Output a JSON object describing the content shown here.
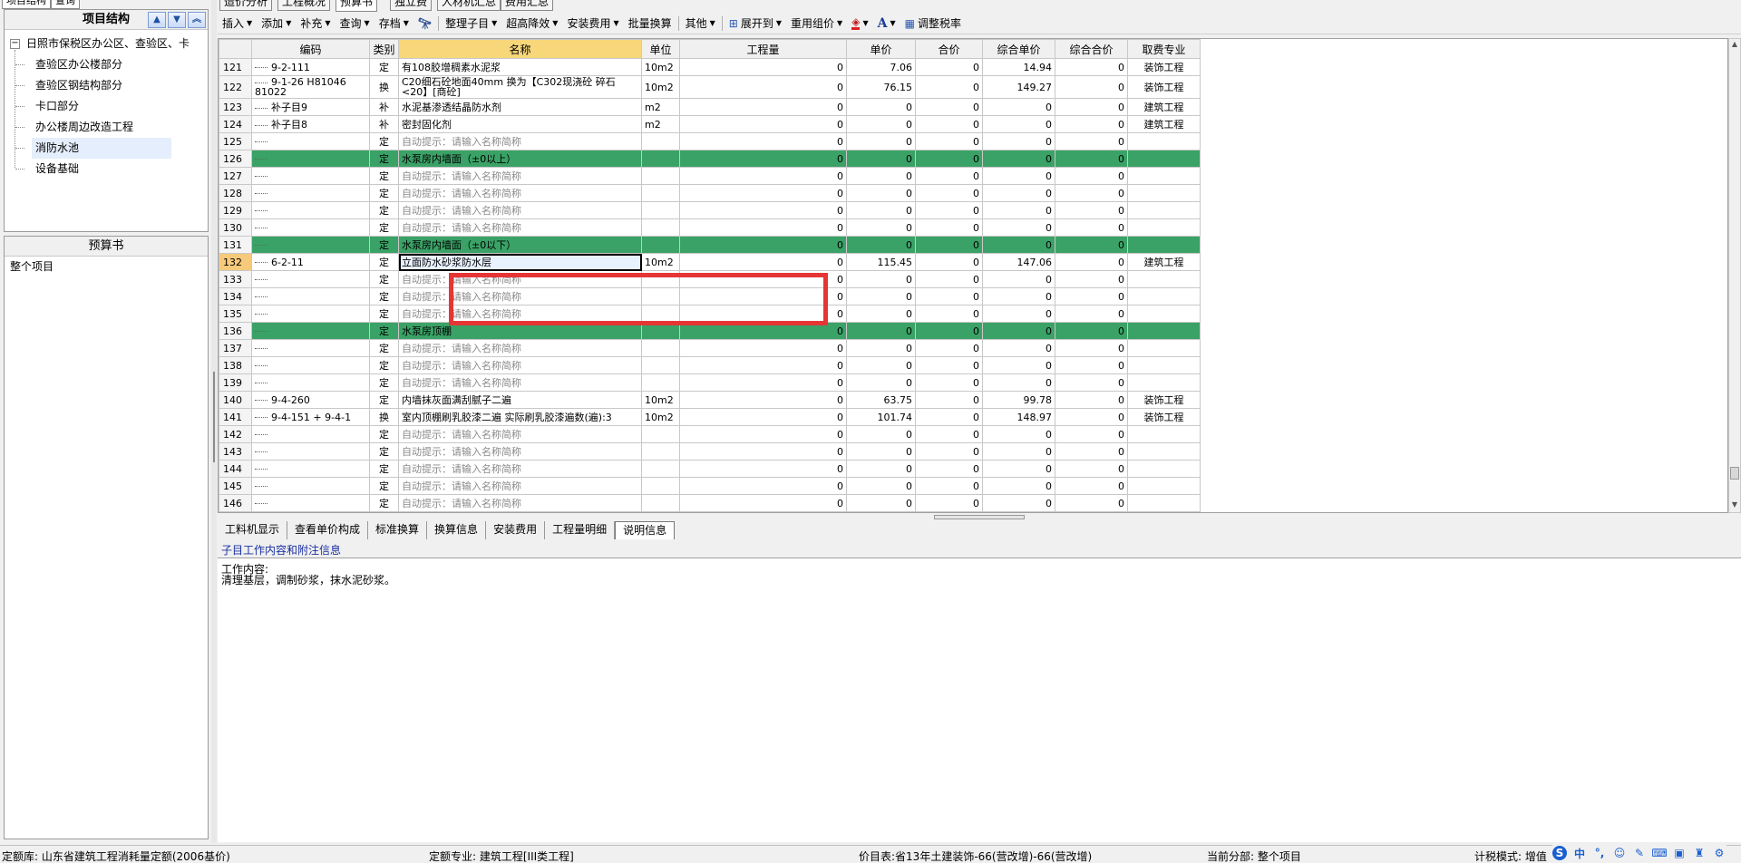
{
  "left_tabs": [
    "项目结构",
    "查询"
  ],
  "project_panel": {
    "title": "项目结构",
    "root": "日照市保税区办公区、查验区、卡",
    "items": [
      "查验区办公楼部分",
      "查验区钢结构部分",
      "卡口部分",
      "办公楼周边改造工程",
      "消防水池",
      "设备基础"
    ],
    "selected_index": 4
  },
  "budget_panel": {
    "title": "预算书",
    "items": [
      "整个项目"
    ]
  },
  "main_tabs": [
    "造价分析",
    "工程概况",
    "预算书",
    "独立费",
    "人材机汇总",
    "费用汇总"
  ],
  "active_main_tab": 2,
  "toolbar": [
    "插入",
    "添加",
    "补充",
    "查询",
    "存档",
    "",
    "整理子目",
    "超高降效",
    "安装费用",
    "批量换算",
    "其他",
    "展开到",
    "重用组价",
    "",
    "A",
    "调整税率"
  ],
  "grid": {
    "headers": [
      "",
      "编码",
      "类别",
      "名称",
      "单位",
      "工程量",
      "单价",
      "合价",
      "综合单价",
      "综合合价",
      "取费专业"
    ],
    "rows": [
      {
        "n": "121",
        "code": "9-2-111",
        "type": "定",
        "name": "有108胶增稠素水泥浆",
        "unit": "10m2",
        "qty": "0",
        "price": "7.06",
        "total": "0",
        "uprice": "14.94",
        "utotal": "0",
        "prof": "装饰工程",
        "kind": "norm"
      },
      {
        "n": "122",
        "code": "9-1-26 H81046 81022",
        "type": "换",
        "name": "C20细石砼地面40mm 换为【C302现浇砼 碎石<20】[商砼]",
        "unit": "10m2",
        "qty": "0",
        "price": "76.15",
        "total": "0",
        "uprice": "149.27",
        "utotal": "0",
        "prof": "装饰工程",
        "kind": "tall"
      },
      {
        "n": "123",
        "code": "补子目9",
        "type": "补",
        "name": "水泥基渗透结晶防水剂",
        "unit": "m2",
        "qty": "0",
        "price": "0",
        "total": "0",
        "uprice": "0",
        "utotal": "0",
        "prof": "建筑工程",
        "kind": "norm"
      },
      {
        "n": "124",
        "code": "补子目8",
        "type": "补",
        "name": "密封固化剂",
        "unit": "m2",
        "qty": "0",
        "price": "0",
        "total": "0",
        "uprice": "0",
        "utotal": "0",
        "prof": "建筑工程",
        "kind": "norm"
      },
      {
        "n": "125",
        "code": "",
        "type": "定",
        "name": "自动提示：请输入名称简称",
        "unit": "",
        "qty": "0",
        "price": "0",
        "total": "0",
        "uprice": "0",
        "utotal": "0",
        "prof": "",
        "kind": "hint"
      },
      {
        "n": "126",
        "code": "",
        "type": "定",
        "name": "水泵房内墙面（±0以上）",
        "unit": "",
        "qty": "0",
        "price": "0",
        "total": "0",
        "uprice": "0",
        "utotal": "0",
        "prof": "",
        "kind": "sec"
      },
      {
        "n": "127",
        "code": "",
        "type": "定",
        "name": "自动提示：请输入名称简称",
        "unit": "",
        "qty": "0",
        "price": "0",
        "total": "0",
        "uprice": "0",
        "utotal": "0",
        "prof": "",
        "kind": "hint"
      },
      {
        "n": "128",
        "code": "",
        "type": "定",
        "name": "自动提示：请输入名称简称",
        "unit": "",
        "qty": "0",
        "price": "0",
        "total": "0",
        "uprice": "0",
        "utotal": "0",
        "prof": "",
        "kind": "hint"
      },
      {
        "n": "129",
        "code": "",
        "type": "定",
        "name": "自动提示：请输入名称简称",
        "unit": "",
        "qty": "0",
        "price": "0",
        "total": "0",
        "uprice": "0",
        "utotal": "0",
        "prof": "",
        "kind": "hint"
      },
      {
        "n": "130",
        "code": "",
        "type": "定",
        "name": "自动提示：请输入名称简称",
        "unit": "",
        "qty": "0",
        "price": "0",
        "total": "0",
        "uprice": "0",
        "utotal": "0",
        "prof": "",
        "kind": "hint"
      },
      {
        "n": "131",
        "code": "",
        "type": "定",
        "name": "水泵房内墙面（±0以下）",
        "unit": "",
        "qty": "0",
        "price": "0",
        "total": "0",
        "uprice": "0",
        "utotal": "0",
        "prof": "",
        "kind": "sec"
      },
      {
        "n": "132",
        "code": "6-2-11",
        "type": "定",
        "name": "立面防水砂浆防水层",
        "unit": "10m2",
        "qty": "0",
        "price": "115.45",
        "total": "0",
        "uprice": "147.06",
        "utotal": "0",
        "prof": "建筑工程",
        "kind": "edit"
      },
      {
        "n": "133",
        "code": "",
        "type": "定",
        "name": "自动提示：请输入名称简称",
        "unit": "",
        "qty": "0",
        "price": "0",
        "total": "0",
        "uprice": "0",
        "utotal": "0",
        "prof": "",
        "kind": "hint"
      },
      {
        "n": "134",
        "code": "",
        "type": "定",
        "name": "自动提示：请输入名称简称",
        "unit": "",
        "qty": "0",
        "price": "0",
        "total": "0",
        "uprice": "0",
        "utotal": "0",
        "prof": "",
        "kind": "hint"
      },
      {
        "n": "135",
        "code": "",
        "type": "定",
        "name": "自动提示：请输入名称简称",
        "unit": "",
        "qty": "0",
        "price": "0",
        "total": "0",
        "uprice": "0",
        "utotal": "0",
        "prof": "",
        "kind": "hint"
      },
      {
        "n": "136",
        "code": "",
        "type": "定",
        "name": "水泵房顶棚",
        "unit": "",
        "qty": "0",
        "price": "0",
        "total": "0",
        "uprice": "0",
        "utotal": "0",
        "prof": "",
        "kind": "sec"
      },
      {
        "n": "137",
        "code": "",
        "type": "定",
        "name": "自动提示：请输入名称简称",
        "unit": "",
        "qty": "0",
        "price": "0",
        "total": "0",
        "uprice": "0",
        "utotal": "0",
        "prof": "",
        "kind": "hint"
      },
      {
        "n": "138",
        "code": "",
        "type": "定",
        "name": "自动提示：请输入名称简称",
        "unit": "",
        "qty": "0",
        "price": "0",
        "total": "0",
        "uprice": "0",
        "utotal": "0",
        "prof": "",
        "kind": "hint"
      },
      {
        "n": "139",
        "code": "",
        "type": "定",
        "name": "自动提示：请输入名称简称",
        "unit": "",
        "qty": "0",
        "price": "0",
        "total": "0",
        "uprice": "0",
        "utotal": "0",
        "prof": "",
        "kind": "hint"
      },
      {
        "n": "140",
        "code": "9-4-260",
        "type": "定",
        "name": "内墙抹灰面满刮腻子二遍",
        "unit": "10m2",
        "qty": "0",
        "price": "63.75",
        "total": "0",
        "uprice": "99.78",
        "utotal": "0",
        "prof": "装饰工程",
        "kind": "norm"
      },
      {
        "n": "141",
        "code": "9-4-151 + 9-4-1",
        "type": "换",
        "name": "室内顶棚刷乳胶漆二遍 实际刷乳胶漆遍数(遍):3",
        "unit": "10m2",
        "qty": "0",
        "price": "101.74",
        "total": "0",
        "uprice": "148.97",
        "utotal": "0",
        "prof": "装饰工程",
        "kind": "norm"
      },
      {
        "n": "142",
        "code": "",
        "type": "定",
        "name": "自动提示：请输入名称简称",
        "unit": "",
        "qty": "0",
        "price": "0",
        "total": "0",
        "uprice": "0",
        "utotal": "0",
        "prof": "",
        "kind": "hint"
      },
      {
        "n": "143",
        "code": "",
        "type": "定",
        "name": "自动提示：请输入名称简称",
        "unit": "",
        "qty": "0",
        "price": "0",
        "total": "0",
        "uprice": "0",
        "utotal": "0",
        "prof": "",
        "kind": "hint"
      },
      {
        "n": "144",
        "code": "",
        "type": "定",
        "name": "自动提示：请输入名称简称",
        "unit": "",
        "qty": "0",
        "price": "0",
        "total": "0",
        "uprice": "0",
        "utotal": "0",
        "prof": "",
        "kind": "hint"
      },
      {
        "n": "145",
        "code": "",
        "type": "定",
        "name": "自动提示：请输入名称简称",
        "unit": "",
        "qty": "0",
        "price": "0",
        "total": "0",
        "uprice": "0",
        "utotal": "0",
        "prof": "",
        "kind": "hint"
      },
      {
        "n": "146",
        "code": "",
        "type": "定",
        "name": "自动提示：请输入名称简称",
        "unit": "",
        "qty": "0",
        "price": "0",
        "total": "0",
        "uprice": "0",
        "utotal": "0",
        "prof": "",
        "kind": "hint"
      }
    ]
  },
  "bottom_tabs": [
    "工料机显示",
    "查看单价构成",
    "标准换算",
    "换算信息",
    "安装费用",
    "工程量明细",
    "说明信息"
  ],
  "active_bottom_tab": 6,
  "info": {
    "title": "子目工作内容和附注信息",
    "line1": "工作内容:",
    "line2": "清理基层，调制砂浆，抹水泥砂浆。"
  },
  "status": {
    "s1": "定额库: 山东省建筑工程消耗量定额(2006基价)",
    "s2": "定额专业: 建筑工程[III类工程]",
    "s3": "价目表:省13年土建装饰-66(营改增)-66(营改增)",
    "s4": "当前分部: 整个项目",
    "s5": "计税模式: 增值"
  },
  "tray": {
    "t1": "中",
    "t2": "°,"
  },
  "colors": {
    "section": "#3aa266",
    "namehead": "#f7d77a",
    "highlight": "#e63535"
  }
}
